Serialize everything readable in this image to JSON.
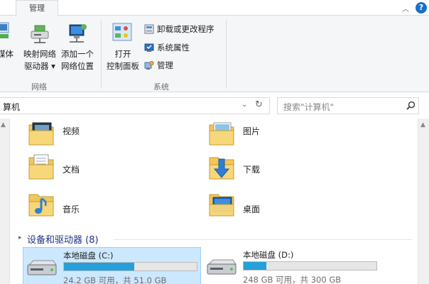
{
  "ribbon": {
    "tab_manage": "管理",
    "network_group": {
      "media_label": "媒体",
      "map_drive_line1": "映射网络",
      "map_drive_line2": "驱动器 ▾",
      "add_location_line1": "添加一个",
      "add_location_line2": "网络位置",
      "label": "网络"
    },
    "system_group": {
      "control_panel_line1": "打开",
      "control_panel_line2": "控制面板",
      "uninstall": "卸载或更改程序",
      "properties": "系统属性",
      "manage": "管理",
      "label": "系统"
    }
  },
  "address": {
    "path": "算机",
    "search_placeholder": "搜索\"计算机\""
  },
  "folders": [
    {
      "label": "视频",
      "icon": "video-folder-icon"
    },
    {
      "label": "图片",
      "icon": "pictures-folder-icon"
    },
    {
      "label": "文档",
      "icon": "documents-folder-icon"
    },
    {
      "label": "下载",
      "icon": "downloads-folder-icon"
    },
    {
      "label": "音乐",
      "icon": "music-folder-icon"
    },
    {
      "label": "桌面",
      "icon": "desktop-folder-icon"
    }
  ],
  "devices": {
    "heading": "设备和驱动器 (8)",
    "drives": [
      {
        "name": "本地磁盘 (C:)",
        "space": "24.2 GB 可用，共 51.0 GB",
        "used_fraction": 0.53,
        "selected": true
      },
      {
        "name": "本地磁盘 (D:)",
        "space": "248 GB 可用，共 300 GB",
        "used_fraction": 0.17,
        "selected": false
      }
    ]
  },
  "colors": {
    "accent": "#26a0da",
    "selection_bg": "#cce8ff",
    "section_heading": "#1e3287",
    "folder_yellow": "#f1c75b"
  }
}
